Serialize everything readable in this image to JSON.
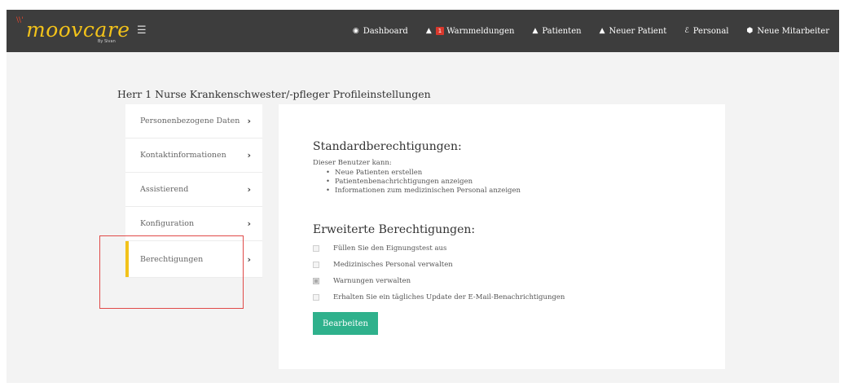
{
  "brand": {
    "name": "moovcare",
    "sub": "By Sivan",
    "sparks": "\\\\'",
    "color": "#f2c21a"
  },
  "nav": {
    "menu_icon": "hamburger-menu-icon",
    "items": [
      {
        "label": "Dashboard",
        "icon": "globe-icon",
        "glyph": "◉"
      },
      {
        "label": "Warnmeldungen",
        "icon": "bell-icon",
        "glyph": "🔔",
        "badge": "1"
      },
      {
        "label": "Patienten",
        "icon": "user-icon",
        "glyph": "👤"
      },
      {
        "label": "Neuer Patient",
        "icon": "user-icon",
        "glyph": "👤"
      },
      {
        "label": "Personal",
        "icon": "user-md-icon",
        "glyph": "ℰ"
      },
      {
        "label": "Neue Mitarbeiter",
        "icon": "shield-icon",
        "glyph": "⬢"
      }
    ]
  },
  "page": {
    "title": "Herr 1 Nurse Krankenschwester/-pfleger Profileinstellungen"
  },
  "sidemenu": {
    "items": [
      {
        "label": "Personenbezogene Daten",
        "active": false
      },
      {
        "label": "Kontaktinformationen",
        "active": false
      },
      {
        "label": "Assistierend",
        "active": false
      },
      {
        "label": "Konfiguration",
        "active": false
      },
      {
        "label": "Berechtigungen",
        "active": true
      }
    ],
    "chevron": "›"
  },
  "permissions": {
    "standard_title": "Standardberechtigungen:",
    "intro": "Dieser Benutzer kann:",
    "standard_items": [
      "Neue Patienten erstellen",
      "Patientenbenachrichtigungen anzeigen",
      "Informationen zum medizinischen Personal anzeigen"
    ],
    "extended_title": "Erweiterte Berechtigungen:",
    "extended_items": [
      {
        "label": "Füllen Sie den Eignungstest aus",
        "checked": false
      },
      {
        "label": "Medizinisches Personal verwalten",
        "checked": false
      },
      {
        "label": "Warnungen verwalten",
        "checked": true
      },
      {
        "label": "Erhalten Sie ein tägliches Update der E-Mail-Benachrichtigungen",
        "checked": false
      }
    ],
    "edit_label": "Bearbeiten"
  },
  "colors": {
    "topbar": "#3d3d3d",
    "accent_yellow": "#f2c21a",
    "button_green": "#2fb18c",
    "highlight_red": "#e04a48",
    "badge_red": "#d9382c"
  }
}
